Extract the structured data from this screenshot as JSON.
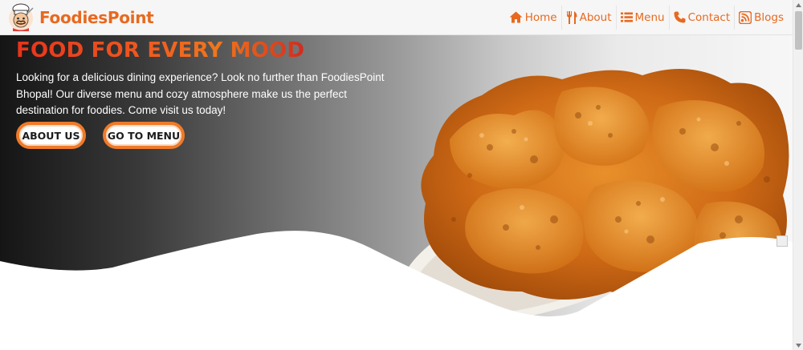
{
  "brand": {
    "name": "FoodiesPoint",
    "logo_icon": "chef-mascot-icon"
  },
  "nav": {
    "items": [
      {
        "label": "Home",
        "icon": "home-icon"
      },
      {
        "label": "About",
        "icon": "fork-knife-icon"
      },
      {
        "label": "Menu",
        "icon": "list-icon"
      },
      {
        "label": "Contact",
        "icon": "phone-icon"
      },
      {
        "label": "Blogs",
        "icon": "blog-icon"
      }
    ]
  },
  "hero": {
    "title": "FOOD FOR EVERY MOOD",
    "description": "Looking for a delicious dining experience? Look no further than FoodiesPoint Bhopal! Our diverse menu and cozy atmosphere make us the perfect destination for foodies. Come visit us today!",
    "buttons": {
      "about": "ABOUT US",
      "menu": "GO TO MENU"
    },
    "image": "fried-chicken-plate"
  },
  "colors": {
    "accent": "#e8691f",
    "title_gradient": [
      "#e8331c",
      "#f0771c",
      "#d12b1e"
    ],
    "button_border": "#ef7a2a"
  }
}
